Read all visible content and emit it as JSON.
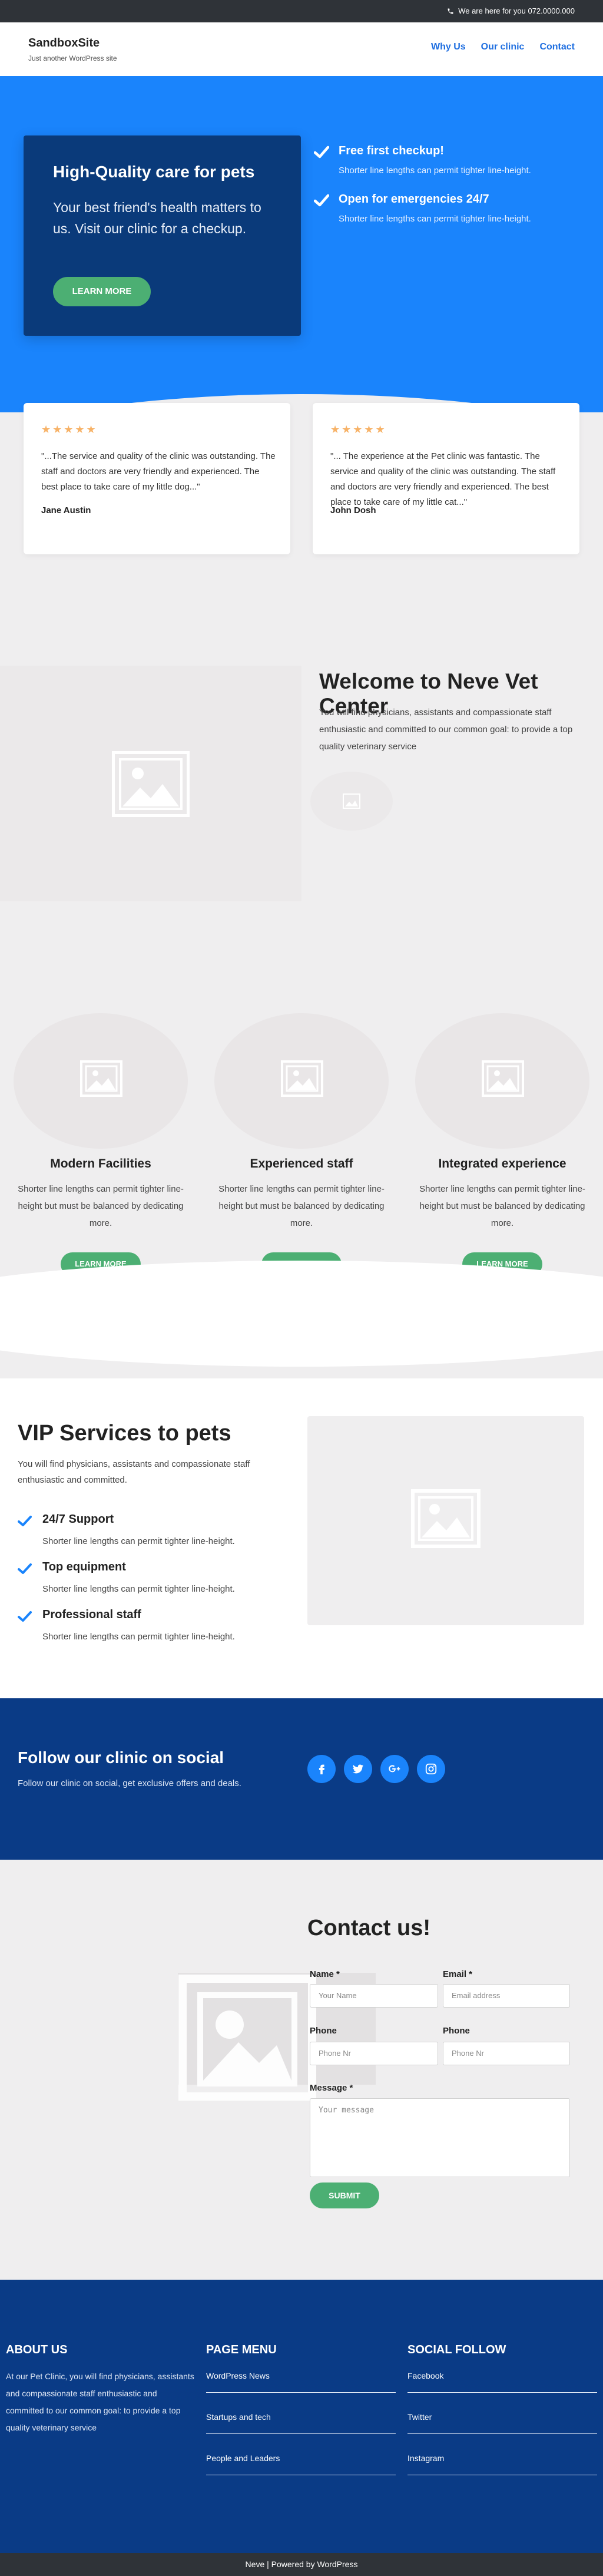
{
  "topbar": {
    "phone_text": "We are here for you 072.0000.000",
    "icon": "phone-icon"
  },
  "header": {
    "site_title": "SandboxSite",
    "tagline": "Just another WordPress site",
    "nav": [
      "Why Us",
      "Our clinic",
      "Contact"
    ]
  },
  "hero": {
    "title": "High-Quality care for pets",
    "text": "Your best friend's health matters to us. Visit our clinic for a checkup.",
    "button": "LEARN MORE",
    "features": [
      {
        "title": "Free first checkup!",
        "text": "Shorter line lengths can permit tighter line-height.",
        "icon": "check-icon"
      },
      {
        "title": "Open for emergencies 24/7",
        "text": "Shorter line lengths can permit tighter line-height.",
        "icon": "check-icon"
      }
    ]
  },
  "testimonials": [
    {
      "stars": "★★★★★",
      "quote": "\"...The service and quality of the clinic was outstanding. The staff and doctors are very friendly and experienced. The best place to take care of my little dog...\"",
      "author": "Jane Austin"
    },
    {
      "stars": "★★★★★",
      "quote": "\"... The experience at the Pet clinic was fantastic. The service and quality of the clinic was outstanding. The staff and doctors are very friendly and experienced. The best place to take care of my little cat...\"",
      "author": "John Dosh"
    }
  ],
  "welcome": {
    "title": "Welcome to Neve Vet Center",
    "text": "You will find physicians, assistants and compassionate staff enthusiastic and committed to our common goal: to provide a top quality veterinary service"
  },
  "features": [
    {
      "title": "Modern Facilities",
      "text": "Shorter line lengths can permit tighter line-height but must be balanced by dedicating more.",
      "button": "LEARN MORE"
    },
    {
      "title": "Experienced staff",
      "text": "Shorter line lengths can permit tighter line-height but must be balanced by dedicating more.",
      "button": "LEARN MORE"
    },
    {
      "title": "Integrated experience",
      "text": "Shorter line lengths can permit tighter line-height but must be balanced by dedicating more.",
      "button": "LEARN MORE"
    }
  ],
  "vip": {
    "title": "VIP Services to pets",
    "text": "You will find physicians, assistants and compassionate staff enthusiastic and committed.",
    "items": [
      {
        "title": "24/7 Support",
        "text": "Shorter line lengths can permit tighter line-height."
      },
      {
        "title": "Top equipment",
        "text": "Shorter line lengths can permit tighter line-height."
      },
      {
        "title": "Professional staff",
        "text": "Shorter line lengths can permit tighter line-height."
      }
    ]
  },
  "social": {
    "title": "Follow our clinic on social",
    "text": "Follow our clinic on social, get exclusive offers and deals.",
    "icons": [
      "facebook-icon",
      "twitter-icon",
      "google-plus-icon",
      "instagram-icon"
    ]
  },
  "contact": {
    "title": "Contact us!",
    "name_label": "Name *",
    "name_placeholder": "Your Name",
    "email_label": "Email *",
    "email_placeholder": "Email address",
    "phone_label_1": "Phone",
    "phone_placeholder_1": "Phone Nr",
    "phone_label_2": "Phone",
    "phone_placeholder_2": "Phone Nr",
    "message_label": "Message *",
    "message_placeholder": "Your message",
    "submit": "SUBMIT"
  },
  "footer": {
    "about_title": "ABOUT US",
    "about_text": "At our Pet Clinic, you will find physicians, assistants and compassionate staff enthusiastic and committed to our common goal: to provide a top quality veterinary service",
    "menu_title": "PAGE MENU",
    "menu_links": [
      "WordPress News",
      "Startups and tech",
      "People and Leaders"
    ],
    "social_title": "SOCIAL FOLLOW",
    "social_links": [
      "Facebook",
      "Twitter",
      "Instagram"
    ],
    "bottom_text": "Neve | Powered by WordPress"
  },
  "colors": {
    "primary": "#1a84fc",
    "dark_blue": "#0a3b86",
    "green": "#4caf73",
    "star": "#f7b267"
  }
}
